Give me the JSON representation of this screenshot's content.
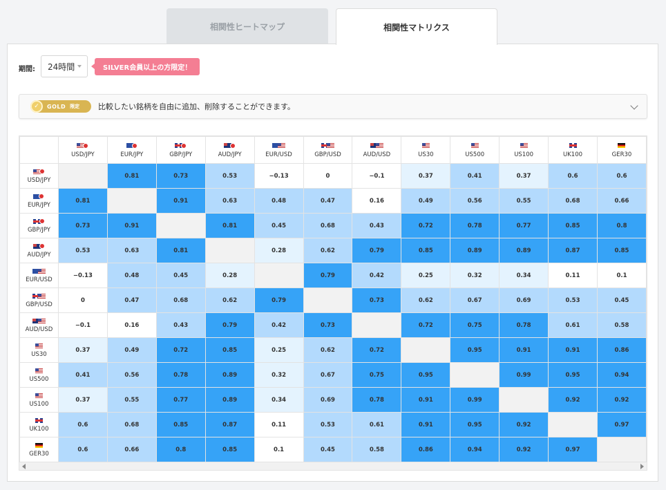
{
  "tabs": [
    {
      "label": "相関性ヒートマップ",
      "active": false
    },
    {
      "label": "相関性マトリクス",
      "active": true
    }
  ],
  "period": {
    "label": "期間:",
    "value": "24時間"
  },
  "silver_notice": "SILVER会員以上の方限定！",
  "gold_bar": {
    "badge": "GOLD",
    "badge_suffix": "限定",
    "description": "比較したい銘柄を自由に追加、削除することができます。"
  },
  "colors": {
    "strong": "#36a3f7",
    "medium": "#b3dafd",
    "light": "#e4f3fe",
    "none": "#ffffff",
    "diagonal": "#f2f2f2"
  },
  "matrix": {
    "symbols": [
      {
        "label": "USD/JPY",
        "flags": [
          "us",
          "jp"
        ]
      },
      {
        "label": "EUR/JPY",
        "flags": [
          "eu",
          "jp"
        ]
      },
      {
        "label": "GBP/JPY",
        "flags": [
          "gb",
          "jp"
        ]
      },
      {
        "label": "AUD/JPY",
        "flags": [
          "au",
          "jp"
        ]
      },
      {
        "label": "EUR/USD",
        "flags": [
          "eu",
          "us"
        ]
      },
      {
        "label": "GBP/USD",
        "flags": [
          "gb",
          "us"
        ]
      },
      {
        "label": "AUD/USD",
        "flags": [
          "au",
          "us"
        ]
      },
      {
        "label": "US30",
        "flags": [
          "us"
        ]
      },
      {
        "label": "US500",
        "flags": [
          "us"
        ]
      },
      {
        "label": "US100",
        "flags": [
          "us"
        ]
      },
      {
        "label": "UK100",
        "flags": [
          "gb"
        ]
      },
      {
        "label": "GER30",
        "flags": [
          "de"
        ]
      }
    ],
    "rows": [
      [
        "",
        "0.81",
        "0.73",
        "0.53",
        "−0.13",
        "0",
        "−0.1",
        "0.37",
        "0.41",
        "0.37",
        "0.6",
        "0.6"
      ],
      [
        "0.81",
        "",
        "0.91",
        "0.63",
        "0.48",
        "0.47",
        "0.16",
        "0.49",
        "0.56",
        "0.55",
        "0.68",
        "0.66"
      ],
      [
        "0.73",
        "0.91",
        "",
        "0.81",
        "0.45",
        "0.68",
        "0.43",
        "0.72",
        "0.78",
        "0.77",
        "0.85",
        "0.8"
      ],
      [
        "0.53",
        "0.63",
        "0.81",
        "",
        "0.28",
        "0.62",
        "0.79",
        "0.85",
        "0.89",
        "0.89",
        "0.87",
        "0.85"
      ],
      [
        "−0.13",
        "0.48",
        "0.45",
        "0.28",
        "",
        "0.79",
        "0.42",
        "0.25",
        "0.32",
        "0.34",
        "0.11",
        "0.1"
      ],
      [
        "0",
        "0.47",
        "0.68",
        "0.62",
        "0.79",
        "",
        "0.73",
        "0.62",
        "0.67",
        "0.69",
        "0.53",
        "0.45"
      ],
      [
        "−0.1",
        "0.16",
        "0.43",
        "0.79",
        "0.42",
        "0.73",
        "",
        "0.72",
        "0.75",
        "0.78",
        "0.61",
        "0.58"
      ],
      [
        "0.37",
        "0.49",
        "0.72",
        "0.85",
        "0.25",
        "0.62",
        "0.72",
        "",
        "0.95",
        "0.91",
        "0.91",
        "0.86"
      ],
      [
        "0.41",
        "0.56",
        "0.78",
        "0.89",
        "0.32",
        "0.67",
        "0.75",
        "0.95",
        "",
        "0.99",
        "0.95",
        "0.94"
      ],
      [
        "0.37",
        "0.55",
        "0.77",
        "0.89",
        "0.34",
        "0.69",
        "0.78",
        "0.91",
        "0.99",
        "",
        "0.92",
        "0.92"
      ],
      [
        "0.6",
        "0.68",
        "0.85",
        "0.87",
        "0.11",
        "0.53",
        "0.61",
        "0.91",
        "0.95",
        "0.92",
        "",
        "0.97"
      ],
      [
        "0.6",
        "0.66",
        "0.8",
        "0.85",
        "0.1",
        "0.45",
        "0.58",
        "0.86",
        "0.94",
        "0.92",
        "0.97",
        ""
      ]
    ]
  }
}
